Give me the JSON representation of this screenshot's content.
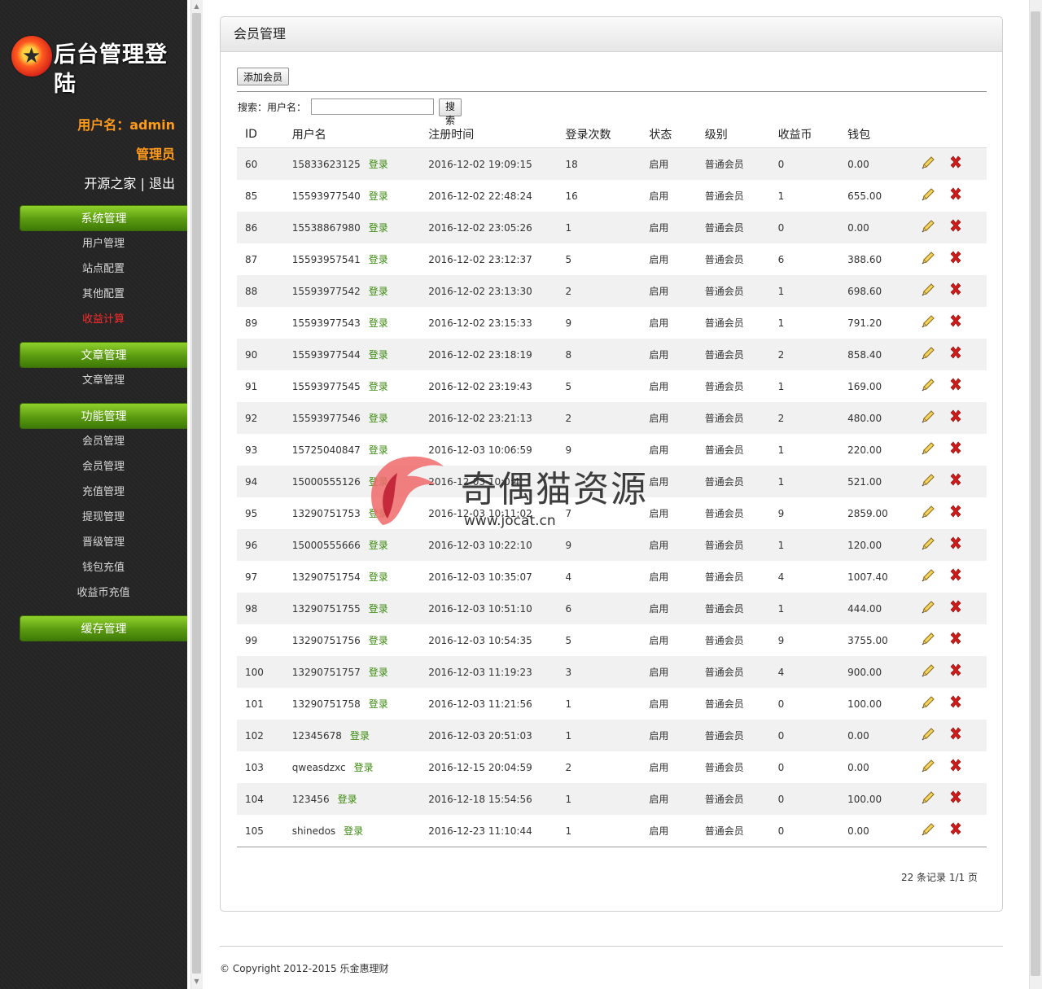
{
  "sidebar": {
    "logo_glyph": "★",
    "logo_title": "后台管理登陆",
    "username_line": "用户名：admin",
    "role": "管理员",
    "site_link": "开源之家",
    "separator": "|",
    "logout": "退出",
    "sections": [
      {
        "title": "系统管理",
        "items": [
          "用户管理",
          "站点配置",
          "其他配置",
          "收益计算"
        ],
        "active": "收益计算"
      },
      {
        "title": "文章管理",
        "items": [
          "文章管理"
        ]
      },
      {
        "title": "功能管理",
        "items": [
          "会员管理",
          "会员管理",
          "充值管理",
          "提现管理",
          "晋级管理",
          "钱包充值",
          "收益币充值"
        ]
      },
      {
        "title": "缓存管理",
        "items": []
      }
    ]
  },
  "panel": {
    "title": "会员管理",
    "add_button": "添加会员",
    "search_label": "搜索：用户名：",
    "search_value": "",
    "search_button": "搜索"
  },
  "table": {
    "columns": [
      "ID",
      "用户名",
      "注册时间",
      "登录次数",
      "状态",
      "级别",
      "收益币",
      "钱包",
      ""
    ],
    "login_label": "登录",
    "rows": [
      [
        "60",
        "15833623125",
        "2016-12-02 19:09:15",
        "18",
        "启用",
        "普通会员",
        "0",
        "0.00"
      ],
      [
        "85",
        "15593977540",
        "2016-12-02 22:48:24",
        "16",
        "启用",
        "普通会员",
        "1",
        "655.00"
      ],
      [
        "86",
        "15538867980",
        "2016-12-02 23:05:26",
        "1",
        "启用",
        "普通会员",
        "0",
        "0.00"
      ],
      [
        "87",
        "15593957541",
        "2016-12-02 23:12:37",
        "5",
        "启用",
        "普通会员",
        "6",
        "388.60"
      ],
      [
        "88",
        "15593977542",
        "2016-12-02 23:13:30",
        "2",
        "启用",
        "普通会员",
        "1",
        "698.60"
      ],
      [
        "89",
        "15593977543",
        "2016-12-02 23:15:33",
        "9",
        "启用",
        "普通会员",
        "1",
        "791.20"
      ],
      [
        "90",
        "15593977544",
        "2016-12-02 23:18:19",
        "8",
        "启用",
        "普通会员",
        "2",
        "858.40"
      ],
      [
        "91",
        "15593977545",
        "2016-12-02 23:19:43",
        "5",
        "启用",
        "普通会员",
        "1",
        "169.00"
      ],
      [
        "92",
        "15593977546",
        "2016-12-02 23:21:13",
        "2",
        "启用",
        "普通会员",
        "2",
        "480.00"
      ],
      [
        "93",
        "15725040847",
        "2016-12-03 10:06:59",
        "9",
        "启用",
        "普通会员",
        "1",
        "220.00"
      ],
      [
        "94",
        "15000555126",
        "2016-12-03 10:0:4",
        "",
        "启用",
        "普通会员",
        "1",
        "521.00"
      ],
      [
        "95",
        "13290751753",
        "2016-12-03 10:11:02",
        "7",
        "启用",
        "普通会员",
        "9",
        "2859.00"
      ],
      [
        "96",
        "15000555666",
        "2016-12-03 10:22:10",
        "9",
        "启用",
        "普通会员",
        "1",
        "120.00"
      ],
      [
        "97",
        "13290751754",
        "2016-12-03 10:35:07",
        "4",
        "启用",
        "普通会员",
        "4",
        "1007.40"
      ],
      [
        "98",
        "13290751755",
        "2016-12-03 10:51:10",
        "6",
        "启用",
        "普通会员",
        "1",
        "444.00"
      ],
      [
        "99",
        "13290751756",
        "2016-12-03 10:54:35",
        "5",
        "启用",
        "普通会员",
        "9",
        "3755.00"
      ],
      [
        "100",
        "13290751757",
        "2016-12-03 11:19:23",
        "3",
        "启用",
        "普通会员",
        "4",
        "900.00"
      ],
      [
        "101",
        "13290751758",
        "2016-12-03 11:21:56",
        "1",
        "启用",
        "普通会员",
        "0",
        "100.00"
      ],
      [
        "102",
        "12345678",
        "2016-12-03 20:51:03",
        "1",
        "启用",
        "普通会员",
        "0",
        "0.00"
      ],
      [
        "103",
        "qweasdzxc",
        "2016-12-15 20:04:59",
        "2",
        "启用",
        "普通会员",
        "0",
        "0.00"
      ],
      [
        "104",
        "123456",
        "2016-12-18 15:54:56",
        "1",
        "启用",
        "普通会员",
        "0",
        "100.00"
      ],
      [
        "105",
        "shinedos",
        "2016-12-23 11:10:44",
        "1",
        "启用",
        "普通会员",
        "0",
        "0.00"
      ]
    ],
    "edit_icon": "pencil-icon",
    "delete_icon": "red-x-icon"
  },
  "pager": "22 条记录 1/1 页",
  "footer": "© Copyright 2012-2015 乐金惠理财",
  "watermark": {
    "text": "奇偶猫资源",
    "url": "www.jocat.cn"
  },
  "colors": {
    "sidebar_bg": "#242424",
    "nav_green": "#5a9a10",
    "username_orange": "#ff9a1a",
    "active_red": "#ff2b2b",
    "login_green": "#3b8a0e",
    "delete_red": "#d11b1b"
  }
}
